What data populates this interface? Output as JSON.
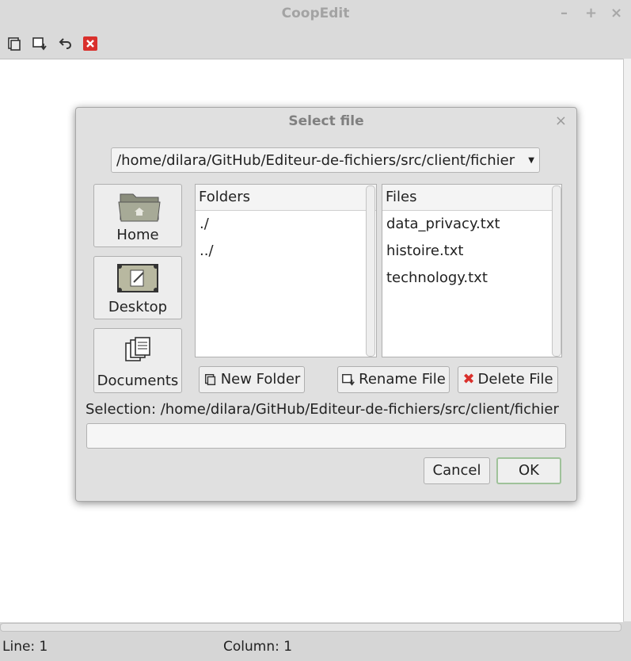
{
  "window": {
    "title": "CoopEdit",
    "minimize": "–",
    "maximize": "+",
    "close": "×"
  },
  "toolbar": {
    "icons": [
      "copy-icon",
      "save-icon",
      "undo-icon",
      "delete-icon"
    ]
  },
  "status": {
    "line": "Line: 1",
    "column": "Column: 1"
  },
  "dialog": {
    "title": "Select file",
    "close": "×",
    "path": "/home/dilara/GitHub/Editeur-de-fichiers/src/client/fichier",
    "places": [
      {
        "label": "Home",
        "icon": "home-folder-icon"
      },
      {
        "label": "Desktop",
        "icon": "desktop-icon"
      },
      {
        "label": "Documents",
        "icon": "documents-icon"
      }
    ],
    "folders": {
      "header": "Folders",
      "items": [
        "./",
        "../"
      ]
    },
    "files": {
      "header": "Files",
      "items": [
        "data_privacy.txt",
        "histoire.txt",
        "technology.txt"
      ]
    },
    "buttons": {
      "new_folder": "New Folder",
      "rename_file": "Rename File",
      "delete_file": "Delete File",
      "cancel": "Cancel",
      "ok": "OK"
    },
    "selection_label": "Selection: /home/dilara/GitHub/Editeur-de-fichiers/src/client/fichier",
    "selection_value": ""
  }
}
